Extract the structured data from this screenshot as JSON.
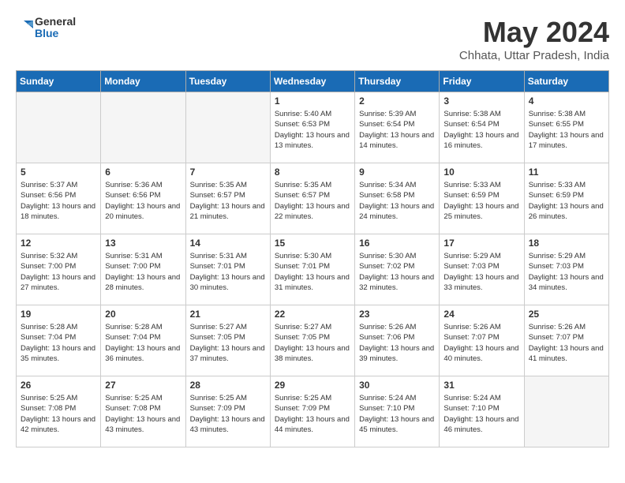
{
  "logo": {
    "line1": "General",
    "line2": "Blue"
  },
  "title": "May 2024",
  "location": "Chhata, Uttar Pradesh, India",
  "days_of_week": [
    "Sunday",
    "Monday",
    "Tuesday",
    "Wednesday",
    "Thursday",
    "Friday",
    "Saturday"
  ],
  "weeks": [
    [
      {
        "day": "",
        "sunrise": "",
        "sunset": "",
        "daylight": ""
      },
      {
        "day": "",
        "sunrise": "",
        "sunset": "",
        "daylight": ""
      },
      {
        "day": "",
        "sunrise": "",
        "sunset": "",
        "daylight": ""
      },
      {
        "day": "1",
        "sunrise": "Sunrise: 5:40 AM",
        "sunset": "Sunset: 6:53 PM",
        "daylight": "Daylight: 13 hours and 13 minutes."
      },
      {
        "day": "2",
        "sunrise": "Sunrise: 5:39 AM",
        "sunset": "Sunset: 6:54 PM",
        "daylight": "Daylight: 13 hours and 14 minutes."
      },
      {
        "day": "3",
        "sunrise": "Sunrise: 5:38 AM",
        "sunset": "Sunset: 6:54 PM",
        "daylight": "Daylight: 13 hours and 16 minutes."
      },
      {
        "day": "4",
        "sunrise": "Sunrise: 5:38 AM",
        "sunset": "Sunset: 6:55 PM",
        "daylight": "Daylight: 13 hours and 17 minutes."
      }
    ],
    [
      {
        "day": "5",
        "sunrise": "Sunrise: 5:37 AM",
        "sunset": "Sunset: 6:56 PM",
        "daylight": "Daylight: 13 hours and 18 minutes."
      },
      {
        "day": "6",
        "sunrise": "Sunrise: 5:36 AM",
        "sunset": "Sunset: 6:56 PM",
        "daylight": "Daylight: 13 hours and 20 minutes."
      },
      {
        "day": "7",
        "sunrise": "Sunrise: 5:35 AM",
        "sunset": "Sunset: 6:57 PM",
        "daylight": "Daylight: 13 hours and 21 minutes."
      },
      {
        "day": "8",
        "sunrise": "Sunrise: 5:35 AM",
        "sunset": "Sunset: 6:57 PM",
        "daylight": "Daylight: 13 hours and 22 minutes."
      },
      {
        "day": "9",
        "sunrise": "Sunrise: 5:34 AM",
        "sunset": "Sunset: 6:58 PM",
        "daylight": "Daylight: 13 hours and 24 minutes."
      },
      {
        "day": "10",
        "sunrise": "Sunrise: 5:33 AM",
        "sunset": "Sunset: 6:59 PM",
        "daylight": "Daylight: 13 hours and 25 minutes."
      },
      {
        "day": "11",
        "sunrise": "Sunrise: 5:33 AM",
        "sunset": "Sunset: 6:59 PM",
        "daylight": "Daylight: 13 hours and 26 minutes."
      }
    ],
    [
      {
        "day": "12",
        "sunrise": "Sunrise: 5:32 AM",
        "sunset": "Sunset: 7:00 PM",
        "daylight": "Daylight: 13 hours and 27 minutes."
      },
      {
        "day": "13",
        "sunrise": "Sunrise: 5:31 AM",
        "sunset": "Sunset: 7:00 PM",
        "daylight": "Daylight: 13 hours and 28 minutes."
      },
      {
        "day": "14",
        "sunrise": "Sunrise: 5:31 AM",
        "sunset": "Sunset: 7:01 PM",
        "daylight": "Daylight: 13 hours and 30 minutes."
      },
      {
        "day": "15",
        "sunrise": "Sunrise: 5:30 AM",
        "sunset": "Sunset: 7:01 PM",
        "daylight": "Daylight: 13 hours and 31 minutes."
      },
      {
        "day": "16",
        "sunrise": "Sunrise: 5:30 AM",
        "sunset": "Sunset: 7:02 PM",
        "daylight": "Daylight: 13 hours and 32 minutes."
      },
      {
        "day": "17",
        "sunrise": "Sunrise: 5:29 AM",
        "sunset": "Sunset: 7:03 PM",
        "daylight": "Daylight: 13 hours and 33 minutes."
      },
      {
        "day": "18",
        "sunrise": "Sunrise: 5:29 AM",
        "sunset": "Sunset: 7:03 PM",
        "daylight": "Daylight: 13 hours and 34 minutes."
      }
    ],
    [
      {
        "day": "19",
        "sunrise": "Sunrise: 5:28 AM",
        "sunset": "Sunset: 7:04 PM",
        "daylight": "Daylight: 13 hours and 35 minutes."
      },
      {
        "day": "20",
        "sunrise": "Sunrise: 5:28 AM",
        "sunset": "Sunset: 7:04 PM",
        "daylight": "Daylight: 13 hours and 36 minutes."
      },
      {
        "day": "21",
        "sunrise": "Sunrise: 5:27 AM",
        "sunset": "Sunset: 7:05 PM",
        "daylight": "Daylight: 13 hours and 37 minutes."
      },
      {
        "day": "22",
        "sunrise": "Sunrise: 5:27 AM",
        "sunset": "Sunset: 7:05 PM",
        "daylight": "Daylight: 13 hours and 38 minutes."
      },
      {
        "day": "23",
        "sunrise": "Sunrise: 5:26 AM",
        "sunset": "Sunset: 7:06 PM",
        "daylight": "Daylight: 13 hours and 39 minutes."
      },
      {
        "day": "24",
        "sunrise": "Sunrise: 5:26 AM",
        "sunset": "Sunset: 7:07 PM",
        "daylight": "Daylight: 13 hours and 40 minutes."
      },
      {
        "day": "25",
        "sunrise": "Sunrise: 5:26 AM",
        "sunset": "Sunset: 7:07 PM",
        "daylight": "Daylight: 13 hours and 41 minutes."
      }
    ],
    [
      {
        "day": "26",
        "sunrise": "Sunrise: 5:25 AM",
        "sunset": "Sunset: 7:08 PM",
        "daylight": "Daylight: 13 hours and 42 minutes."
      },
      {
        "day": "27",
        "sunrise": "Sunrise: 5:25 AM",
        "sunset": "Sunset: 7:08 PM",
        "daylight": "Daylight: 13 hours and 43 minutes."
      },
      {
        "day": "28",
        "sunrise": "Sunrise: 5:25 AM",
        "sunset": "Sunset: 7:09 PM",
        "daylight": "Daylight: 13 hours and 43 minutes."
      },
      {
        "day": "29",
        "sunrise": "Sunrise: 5:25 AM",
        "sunset": "Sunset: 7:09 PM",
        "daylight": "Daylight: 13 hours and 44 minutes."
      },
      {
        "day": "30",
        "sunrise": "Sunrise: 5:24 AM",
        "sunset": "Sunset: 7:10 PM",
        "daylight": "Daylight: 13 hours and 45 minutes."
      },
      {
        "day": "31",
        "sunrise": "Sunrise: 5:24 AM",
        "sunset": "Sunset: 7:10 PM",
        "daylight": "Daylight: 13 hours and 46 minutes."
      },
      {
        "day": "",
        "sunrise": "",
        "sunset": "",
        "daylight": ""
      }
    ]
  ]
}
